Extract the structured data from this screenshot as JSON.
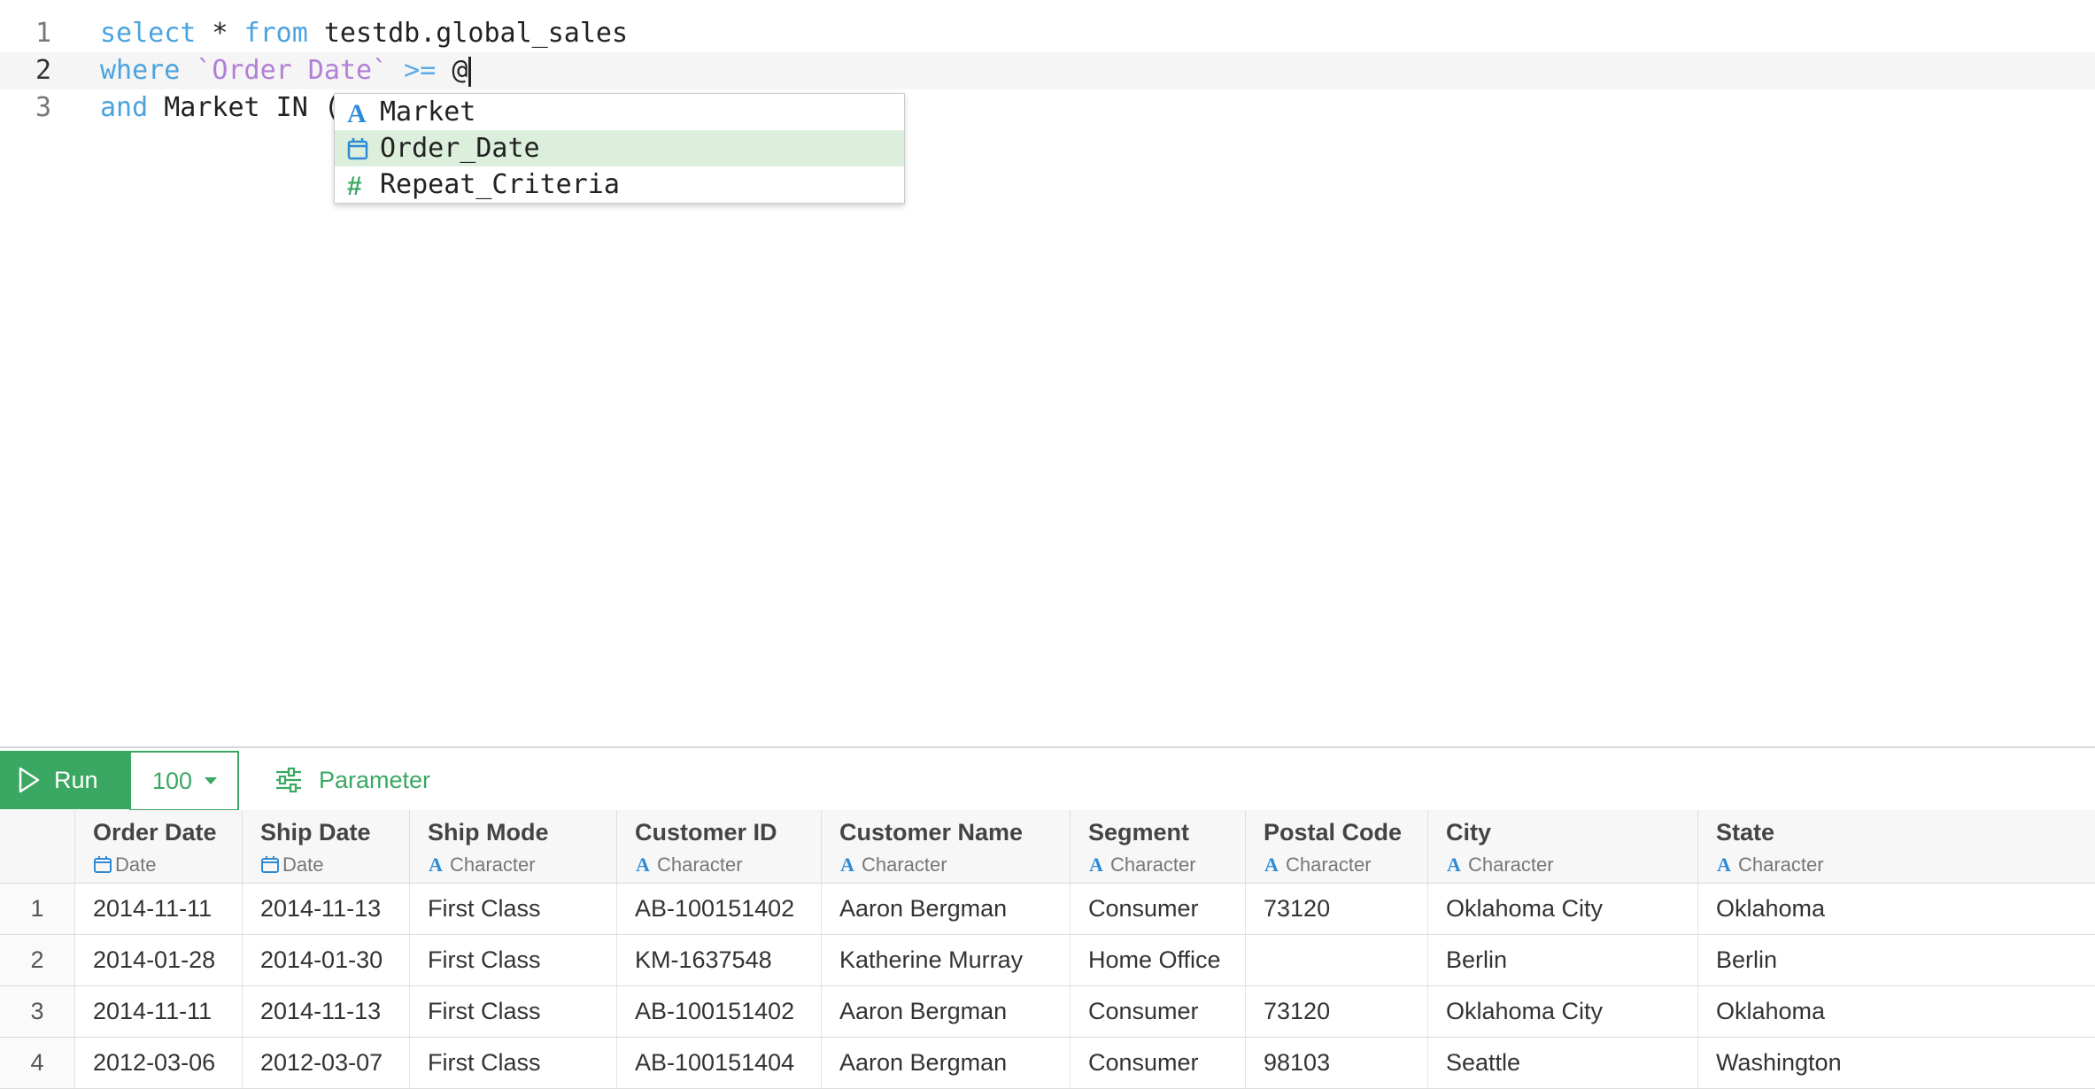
{
  "editor": {
    "line_numbers": [
      "1",
      "2",
      "3"
    ],
    "line1": {
      "kw_select": "select",
      "star": " * ",
      "kw_from": "from",
      "table": " testdb.global_sales"
    },
    "line2": {
      "kw_where": "where",
      "column": " `Order Date`",
      "op": " >=",
      "at": " @"
    },
    "line3": {
      "kw_and": "and",
      "rest": " Market IN ("
    }
  },
  "autocomplete": {
    "items": [
      {
        "label": "Market",
        "icon": "character-icon"
      },
      {
        "label": "Order_Date",
        "icon": "calendar-icon",
        "selected": true
      },
      {
        "label": "Repeat_Criteria",
        "icon": "number-icon"
      }
    ]
  },
  "toolbar": {
    "run_label": "Run",
    "limit_value": "100",
    "parameter_label": "Parameter"
  },
  "colors": {
    "accent": "#3aa862",
    "keyword": "#4aa3df",
    "string": "#b27fd6",
    "selected_item": "#dcefdc"
  },
  "table": {
    "columns": [
      {
        "name": "Order Date",
        "type": "Date"
      },
      {
        "name": "Ship Date",
        "type": "Date"
      },
      {
        "name": "Ship Mode",
        "type": "Character"
      },
      {
        "name": "Customer ID",
        "type": "Character"
      },
      {
        "name": "Customer Name",
        "type": "Character"
      },
      {
        "name": "Segment",
        "type": "Character"
      },
      {
        "name": "Postal Code",
        "type": "Character"
      },
      {
        "name": "City",
        "type": "Character"
      },
      {
        "name": "State",
        "type": "Character"
      }
    ],
    "rows": [
      [
        "1",
        "2014-11-11",
        "2014-11-13",
        "First Class",
        "AB-100151402",
        "Aaron Bergman",
        "Consumer",
        "73120",
        "Oklahoma City",
        "Oklahoma"
      ],
      [
        "2",
        "2014-01-28",
        "2014-01-30",
        "First Class",
        "KM-1637548",
        "Katherine Murray",
        "Home Office",
        "",
        "Berlin",
        "Berlin"
      ],
      [
        "3",
        "2014-11-11",
        "2014-11-13",
        "First Class",
        "AB-100151402",
        "Aaron Bergman",
        "Consumer",
        "73120",
        "Oklahoma City",
        "Oklahoma"
      ],
      [
        "4",
        "2012-03-06",
        "2012-03-07",
        "First Class",
        "AB-100151404",
        "Aaron Bergman",
        "Consumer",
        "98103",
        "Seattle",
        "Washington"
      ]
    ]
  }
}
